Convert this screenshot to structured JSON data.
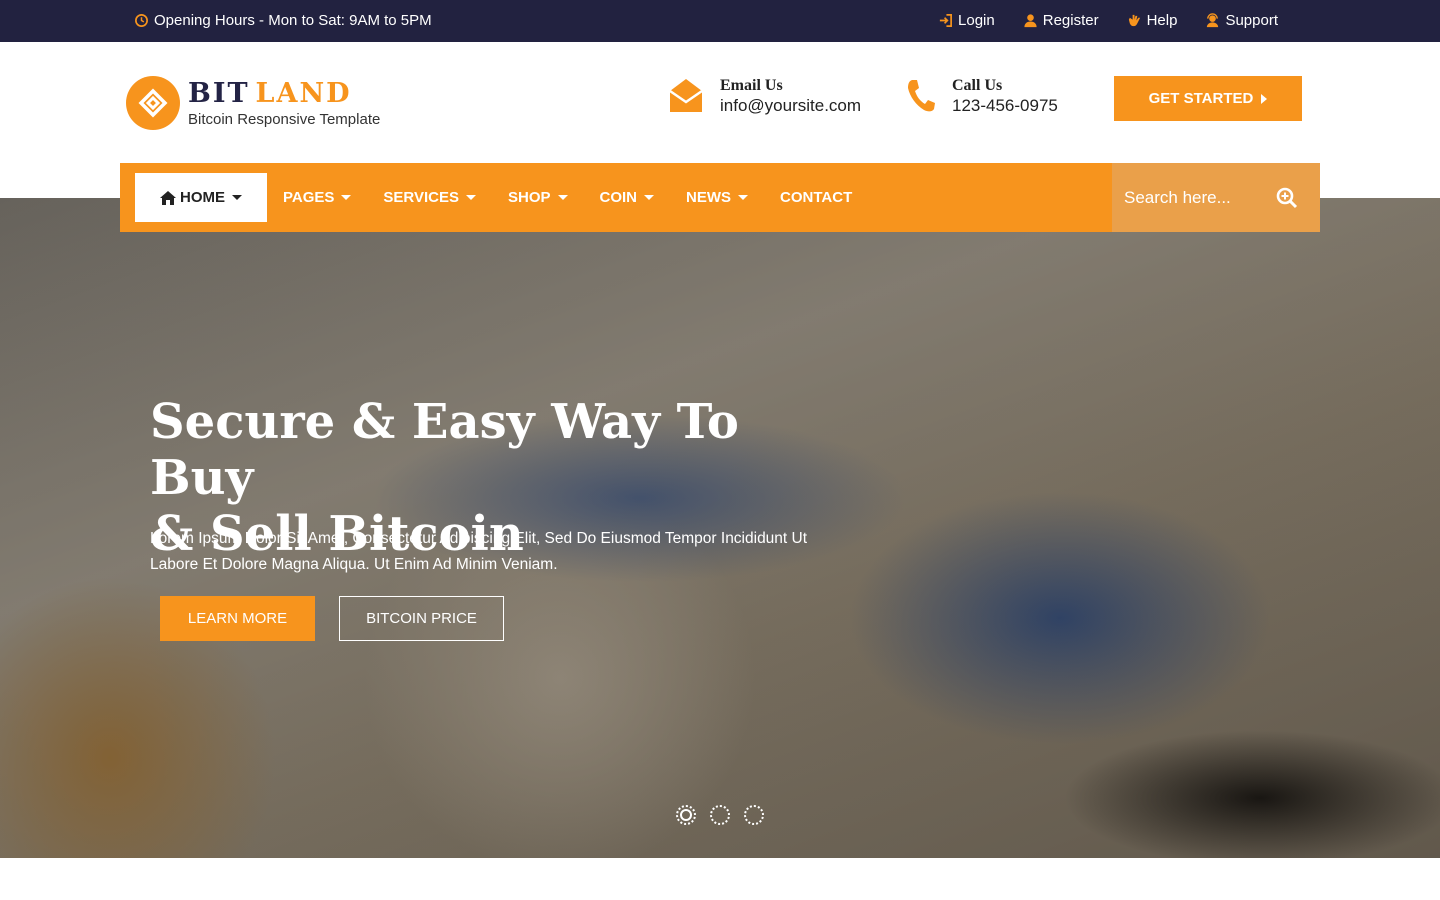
{
  "topbar": {
    "hours": "Opening Hours - Mon to Sat: 9AM to 5PM",
    "links": [
      {
        "label": "Login",
        "icon": "login-icon"
      },
      {
        "label": "Register",
        "icon": "user-icon"
      },
      {
        "label": "Help",
        "icon": "hand-icon"
      },
      {
        "label": "Support",
        "icon": "support-icon"
      }
    ]
  },
  "brand": {
    "name_part1": "BIT",
    "name_part2": "LAND",
    "tagline": "Bitcoin Responsive Template"
  },
  "contact": {
    "email_label": "Email Us",
    "email_value": "info@yoursite.com",
    "phone_label": "Call Us",
    "phone_value": "123-456-0975"
  },
  "cta": {
    "get_started": "GET STARTED"
  },
  "nav": {
    "items": [
      {
        "label": "HOME",
        "dropdown": true,
        "active": true
      },
      {
        "label": "PAGES",
        "dropdown": true
      },
      {
        "label": "SERVICES",
        "dropdown": true
      },
      {
        "label": "SHOP",
        "dropdown": true
      },
      {
        "label": "COIN",
        "dropdown": true
      },
      {
        "label": "NEWS",
        "dropdown": true
      },
      {
        "label": "CONTACT",
        "dropdown": false
      }
    ],
    "search_placeholder": "Search here..."
  },
  "hero": {
    "title_line1": "Secure & Easy Way To Buy",
    "title_line2": "& Sell Bitcoin",
    "text": "Lorem Ipsum Dolor Sit Amet, Consectetur Adipiscing Elit, Sed Do Eiusmod Tempor Incididunt Ut Labore Et Dolore Magna Aliqua. Ut Enim Ad Minim Veniam.",
    "learn_more": "LEARN MORE",
    "bitcoin_price": "BITCOIN PRICE",
    "slides": 3,
    "active_slide": 1
  },
  "colors": {
    "accent": "#f7941d",
    "topbar": "#222240",
    "search_bg": "#eaa04a"
  }
}
